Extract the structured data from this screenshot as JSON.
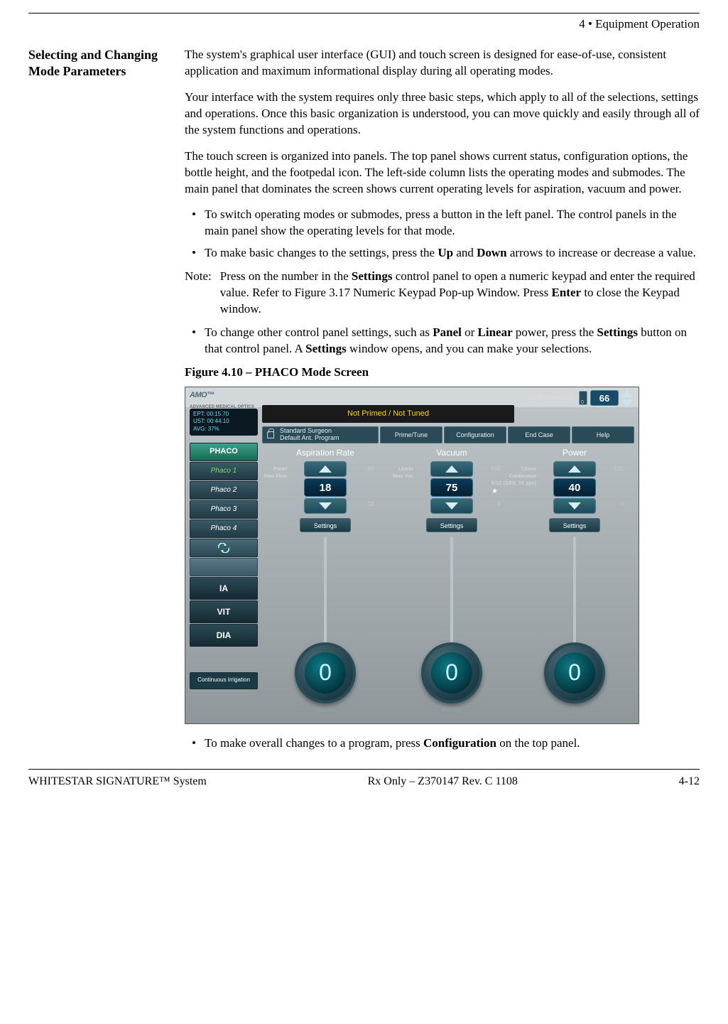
{
  "header": {
    "chapter": "4  • Equipment Operation"
  },
  "section_title": "Selecting and Changing Mode Parameters",
  "paragraphs": {
    "p1": "The system's graphical user interface (GUI) and touch screen is designed for ease-of-use, consistent application and maximum informational display during all operating modes.",
    "p2": "Your interface with the system requires only three basic steps, which apply to all of the selections, settings and operations. Once this basic organization is understood, you can move quickly and easily through all of the system functions and operations.",
    "p3": "The touch screen is organized into panels. The top panel shows current status, configuration options, the bottle height, and the footpedal icon. The left-side column lists the operating modes and submodes. The main panel that dominates the screen shows current operating levels for aspiration, vacuum and power."
  },
  "bullets": {
    "b1": "To switch operating modes or submodes, press a button in the left panel. The control panels in the main panel show the operating levels for that mode.",
    "b2_pre": "To make basic changes to the settings, press the ",
    "b2_up": "Up",
    "b2_mid": " and ",
    "b2_down": "Down",
    "b2_post": " arrows to increase or decrease a value.",
    "note_label": "Note:",
    "note_pre": "Press on the number in the ",
    "note_s1": "Settings",
    "note_mid": " control panel to open a numeric keypad and enter the required value. Refer to Figure 3.17 Numeric Keypad Pop-up Window. Press ",
    "note_enter": "Enter",
    "note_post": " to close the Keypad window.",
    "b3_pre": "To change other control panel settings, such as ",
    "b3_panel": "Panel",
    "b3_or": " or ",
    "b3_linear": "Linear",
    "b3_mid": " power, press the ",
    "b3_settings": "Settings",
    "b3_mid2": " button on that control panel. A ",
    "b3_settings2": "Settings",
    "b3_post": " window opens, and you can make your selections.",
    "b4_pre": "To make overall changes to a program, press ",
    "b4_config": "Configuration",
    "b4_post": " on the top panel."
  },
  "figure_caption": "Figure 4.10 – PHACO Mode Screen",
  "screenshot": {
    "logo": "AMO",
    "logo_sub": "ADVANCED MEDICAL OPTICS",
    "status": "Not Primed / Not Tuned",
    "bottle_label": "Bottle Height (cm)",
    "bottle_value": "66",
    "stats": {
      "l1": "EPT: 00:15.70",
      "l2": "UST: 00:44.10",
      "l3": "AVG: 37%"
    },
    "topbuttons": {
      "surgeon_l1": "Standard Surgeon",
      "surgeon_l2": "Default Ant. Program",
      "prime": "Prime/Tune",
      "config": "Configuration",
      "endcase": "End Case",
      "help": "Help"
    },
    "sidebar": [
      "PHACO",
      "Phaco 1",
      "Phaco 2",
      "Phaco 3",
      "Phaco 4"
    ],
    "sidebar_big": [
      "IA",
      "VIT",
      "DIA"
    ],
    "sidebar_ci": "Continuous Irrigation",
    "columns": {
      "asp": {
        "title": "Aspiration Rate",
        "info_l1": "Panel",
        "info_l2": "Max Flow",
        "max": "60",
        "val": "18",
        "min": "10",
        "settings": "Settings",
        "dial": "0",
        "unit": "cc/min"
      },
      "vac": {
        "title": "Vacuum",
        "info_l1": "Linear",
        "info_l2": "Max Vac",
        "max": "650",
        "val": "75",
        "min": "0",
        "settings": "Settings",
        "dial": "0",
        "unit": "mmHg"
      },
      "pow": {
        "title": "Power",
        "info_l1": "Linear",
        "info_l2": "Continuous",
        "info_l3": "6/12 (33%, 55 pps)",
        "max": "100",
        "val": "40",
        "min": "0",
        "settings": "Settings",
        "dial": "0",
        "unit": "%"
      }
    }
  },
  "footer": {
    "left": "WHITESTAR SIGNATURE™ System",
    "center": "Rx Only – Z370147 Rev. C 1108",
    "right": "4-12"
  }
}
